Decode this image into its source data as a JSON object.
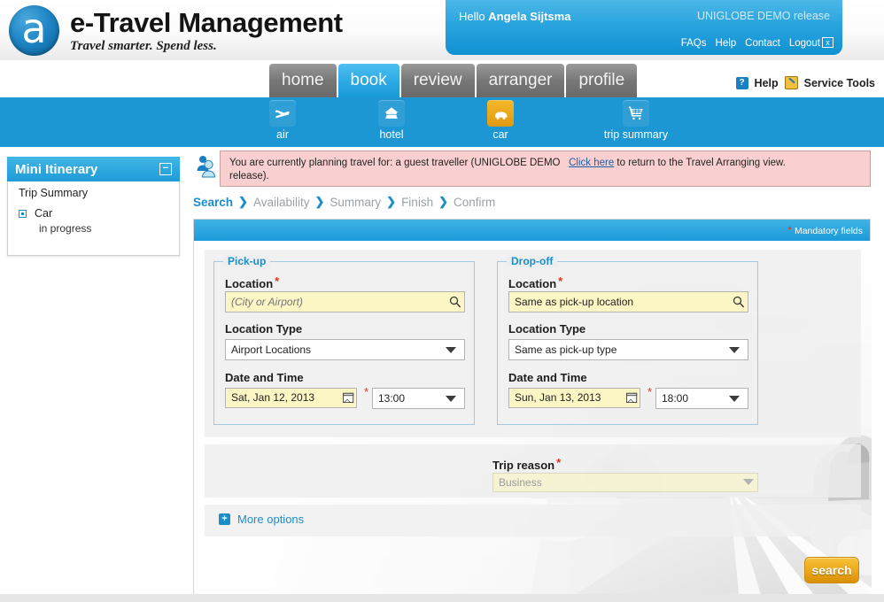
{
  "brand": {
    "logo_letter": "a",
    "title": "e-Travel Management",
    "tagline": "Travel smarter. Spend less."
  },
  "welcome": {
    "greeting_prefix": "Hello ",
    "user_name": "Angela Sijtsma",
    "release": "UNIGLOBE DEMO release",
    "links": [
      "FAQs",
      "Help",
      "Contact",
      "Logout"
    ],
    "logout_close": "x"
  },
  "nav": {
    "tabs": [
      {
        "label": "home",
        "active": false
      },
      {
        "label": "book",
        "active": true
      },
      {
        "label": "review",
        "active": false
      },
      {
        "label": "arranger",
        "active": false
      },
      {
        "label": "profile",
        "active": false
      }
    ],
    "tools": {
      "help_badge": "?",
      "help_label": "Help",
      "service_label": "Service Tools"
    }
  },
  "icon_bar": {
    "items": [
      {
        "label": "air",
        "icon": "airplane-icon",
        "highlighted": false
      },
      {
        "label": "hotel",
        "icon": "hotel-bed-icon",
        "highlighted": false
      },
      {
        "label": "car",
        "icon": "car-icon",
        "highlighted": true
      },
      {
        "label": "trip summary",
        "icon": "shopping-cart-icon",
        "highlighted": false
      }
    ]
  },
  "sidebar": {
    "title": "Mini Itinerary",
    "collapse_symbol": "−",
    "trip_summary_label": "Trip Summary",
    "items": [
      {
        "label": "Car",
        "status": "in progress"
      }
    ]
  },
  "notice": {
    "icon": "guest-traveller-icon",
    "text_before": "You are currently planning travel for: a guest traveller  (UNIGLOBE DEMO release).",
    "line1_a": "You are currently planning travel for: a guest traveller  (UNIGLOBE DEMO",
    "link": "Click here",
    "line1_b": " to return to the Travel Arranging view.",
    "line2": "release)."
  },
  "steps": {
    "items": [
      "Search",
      "Availability",
      "Summary",
      "Finish",
      "Confirm"
    ],
    "active_index": 0,
    "separator": "❯"
  },
  "panel": {
    "mandatory_label": "Mandatory fields",
    "mandatory_star": "*"
  },
  "pickup": {
    "legend": "Pick-up",
    "location_label": "Location",
    "location_value": "",
    "location_placeholder": "(City or Airport)",
    "location_type_label": "Location Type",
    "location_type_value": "Airport Locations",
    "datetime_label": "Date and Time",
    "date_value": "Sat, Jan 12, 2013",
    "time_value": "13:00"
  },
  "dropoff": {
    "legend": "Drop-off",
    "location_label": "Location",
    "location_value": "Same as pick-up location",
    "location_placeholder": "",
    "location_type_label": "Location Type",
    "location_type_value": "Same as pick-up type",
    "datetime_label": "Date and Time",
    "date_value": "Sun, Jan 13, 2013",
    "time_value": "18:00"
  },
  "trip_reason": {
    "label": "Trip reason",
    "value": "Business"
  },
  "more_options": {
    "plus": "+",
    "label": "More options"
  },
  "actions": {
    "search_label": "search"
  },
  "colors": {
    "brand_blue": "#1c97d4",
    "accent_orange": "#eda81b",
    "required_red": "#e8341c",
    "notice_pink": "#f9cfcf",
    "field_yellow": "#fbf6c4",
    "link_blue": "#1b8ec9"
  }
}
